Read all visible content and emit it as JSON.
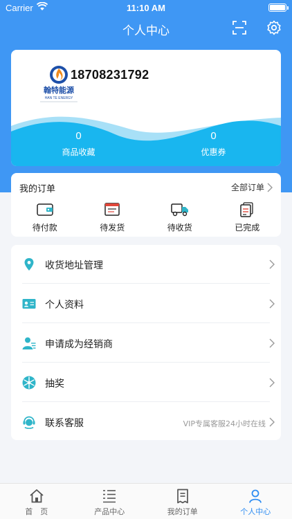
{
  "status_bar": {
    "carrier": "Carrier",
    "time": "11:10 AM"
  },
  "header": {
    "title": "个人中心"
  },
  "profile": {
    "logo_title": "翰特能源",
    "logo_subtitle": "HAN TE ENERGY",
    "phone": "18708231792",
    "stats": [
      {
        "value": "0",
        "label": "商品收藏"
      },
      {
        "value": "0",
        "label": "优惠券"
      }
    ]
  },
  "orders": {
    "title": "我的订单",
    "all_label": "全部订单",
    "items": [
      {
        "label": "待付款",
        "icon": "wallet-icon"
      },
      {
        "label": "待发货",
        "icon": "invoice-icon"
      },
      {
        "label": "待收货",
        "icon": "truck-icon"
      },
      {
        "label": "已完成",
        "icon": "completed-doc-icon"
      }
    ]
  },
  "menu": [
    {
      "label": "收货地址管理",
      "icon": "location-pin-icon",
      "extra": ""
    },
    {
      "label": "个人资料",
      "icon": "id-card-icon",
      "extra": ""
    },
    {
      "label": "申请成为经销商",
      "icon": "dealer-icon",
      "extra": ""
    },
    {
      "label": "抽奖",
      "icon": "lottery-wheel-icon",
      "extra": ""
    },
    {
      "label": "联系客服",
      "icon": "customer-service-icon",
      "extra": "VIP专属客服24小时在线"
    }
  ],
  "tabbar": [
    {
      "label": "首　页",
      "icon": "home-icon",
      "active": false
    },
    {
      "label": "产品中心",
      "icon": "product-list-icon",
      "active": false
    },
    {
      "label": "我的订单",
      "icon": "orders-icon",
      "active": false
    },
    {
      "label": "个人中心",
      "icon": "person-icon",
      "active": true
    }
  ],
  "colors": {
    "primary": "#3f97f4",
    "wave_light": "#a8e0f7",
    "wave_main": "#19b6ef",
    "tab_active": "#2f8df2",
    "icon_teal": "#2fb5c9"
  }
}
